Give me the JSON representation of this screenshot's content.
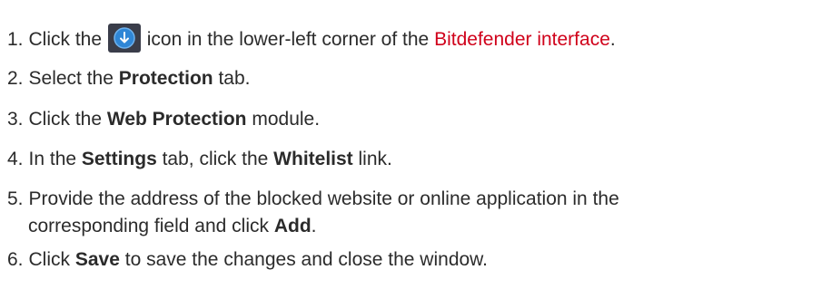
{
  "steps": [
    {
      "number": "1.",
      "parts": [
        "Click the",
        "icon in the lower-left corner of the",
        "Bitdefender interface",
        "."
      ]
    },
    {
      "number": "2.",
      "parts": [
        "Select the",
        "Protection",
        "tab."
      ]
    },
    {
      "number": "3.",
      "parts": [
        "Click the",
        "Web Protection",
        "module."
      ]
    },
    {
      "number": "4.",
      "parts": [
        "In the",
        "Settings",
        "tab, click the",
        "Whitelist",
        "link."
      ]
    },
    {
      "number": "5.",
      "parts": [
        "Provide the address of the blocked website or online application in the",
        "corresponding field and click",
        "Add",
        "."
      ]
    },
    {
      "number": "6.",
      "parts": [
        "Click",
        "Save",
        "to save the changes and close the window."
      ]
    }
  ],
  "icons": {
    "menu_icon": "circle-down-arrow-icon"
  },
  "colors": {
    "text": "#2b2b2b",
    "link": "#d0021b",
    "icon_bg": "#3a3d4a",
    "icon_circle": "#2f86d6"
  }
}
